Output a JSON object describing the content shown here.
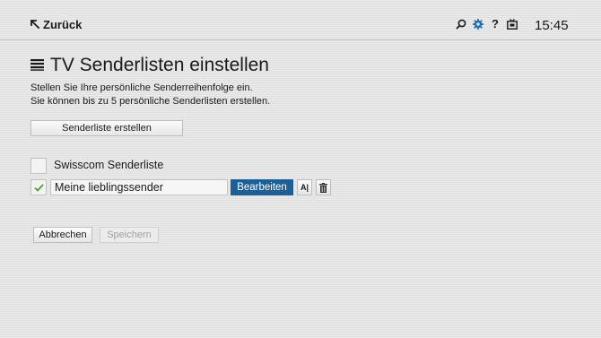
{
  "header": {
    "back_label": "Zurück",
    "help_glyph": "?",
    "time": "15:45",
    "icons": [
      "search-icon",
      "settings-gear-icon",
      "help-icon",
      "tv-icon"
    ],
    "accent_color": "#1e6fb0"
  },
  "page": {
    "title": "TV Senderlisten einstellen",
    "title_icon": "list-icon",
    "description_line1": "Stellen Sie Ihre persönliche Senderreihenfolge ein.",
    "description_line2": "Sie können bis zu 5 persönliche Senderlisten erstellen."
  },
  "actions": {
    "create_label": "Senderliste erstellen",
    "cancel_label": "Abbrechen",
    "save_label": "Speichern"
  },
  "lists": [
    {
      "name": "Swisscom Senderliste",
      "checked": false
    },
    {
      "name": "Meine lieblingssender",
      "checked": true,
      "edit_label": "Bearbeiten",
      "rename_glyph": "A|"
    }
  ],
  "colors": {
    "primary_button": "#1e5f96",
    "checkmark": "#4aa02c"
  }
}
